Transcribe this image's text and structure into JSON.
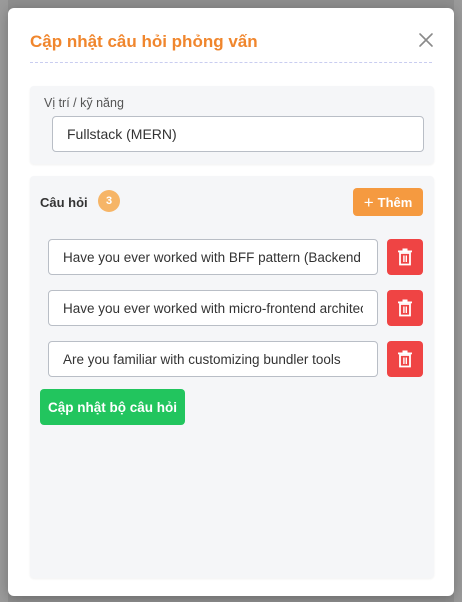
{
  "modal": {
    "title": "Cập nhật câu hỏi phỏng vấn",
    "close_icon": "close-icon"
  },
  "position": {
    "label": "Vị trí / kỹ năng",
    "value": "Fullstack (MERN)"
  },
  "questions": {
    "title": "Câu hỏi",
    "count": "3",
    "add_label": "Thêm",
    "items": [
      {
        "value": "Have you ever worked with BFF pattern (Backend for Frontend)?"
      },
      {
        "value": "Have you ever worked with micro-frontend architecture?"
      },
      {
        "value": "Are you familiar with customizing bundler tools"
      }
    ],
    "delete_icon": "trash-icon"
  },
  "submit_label": "Cập nhật bộ câu hỏi",
  "colors": {
    "accent": "#f0862d",
    "add_button": "#f59a40",
    "delete_button": "#ef4444",
    "submit_button": "#22c55e",
    "badge": "#f6b567"
  }
}
